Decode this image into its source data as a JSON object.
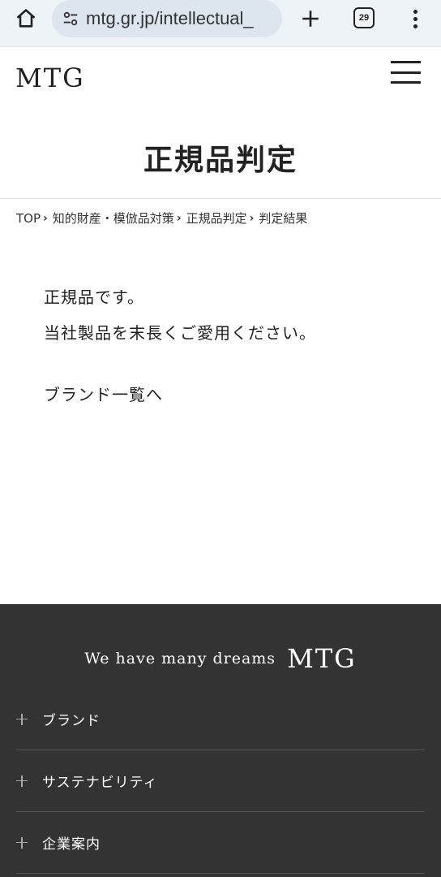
{
  "browser": {
    "url": "mtg.gr.jp/intellectual_",
    "tab_count": "29",
    "icons": [
      "home-icon",
      "tune-icon",
      "plus-icon",
      "tabs-icon",
      "more-vert-icon"
    ]
  },
  "header": {
    "logo": "MTG",
    "menu_icon": "hamburger-menu-icon"
  },
  "page": {
    "title": "正規品判定"
  },
  "breadcrumb": {
    "items": [
      "TOP",
      "知的財産・模倣品対策",
      "正規品判定",
      "判定結果"
    ]
  },
  "result": {
    "line1": "正規品です。",
    "line2": "当社製品を末長くご愛用ください。",
    "brand_link": "ブランド一覧へ"
  },
  "footer": {
    "tagline": "We have many dreams",
    "logo": "MTG",
    "nav": [
      {
        "label": "ブランド"
      },
      {
        "label": "サステナビリティ"
      },
      {
        "label": "企業案内"
      }
    ]
  },
  "colors": {
    "browser_bar": "#eef3f8",
    "url_pill": "#dde6ef",
    "footer_bg": "#333333",
    "text": "#222222"
  }
}
